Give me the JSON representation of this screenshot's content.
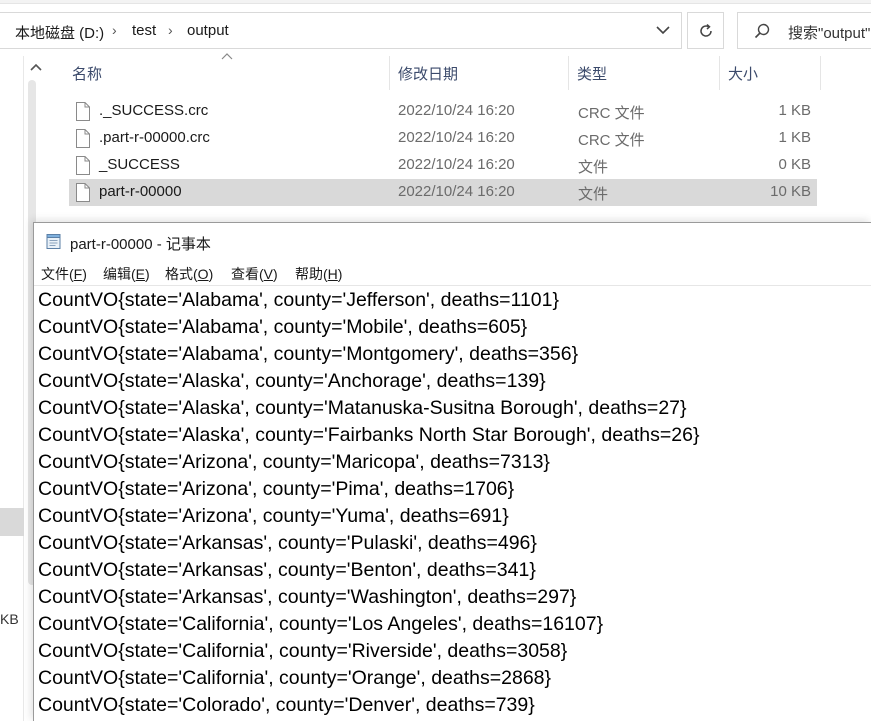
{
  "explorer": {
    "breadcrumb": [
      "本地磁盘 (D:)",
      "test",
      "output"
    ],
    "search_placeholder": "搜索\"output\"",
    "left_pane_size_fragment": "KB",
    "columns": {
      "name": "名称",
      "date": "修改日期",
      "type": "类型",
      "size": "大小"
    },
    "files": [
      {
        "name": "._SUCCESS.crc",
        "date": "2022/10/24 16:20",
        "type": "CRC 文件",
        "size": "1 KB"
      },
      {
        "name": ".part-r-00000.crc",
        "date": "2022/10/24 16:20",
        "type": "CRC 文件",
        "size": "1 KB"
      },
      {
        "name": "_SUCCESS",
        "date": "2022/10/24 16:20",
        "type": "文件",
        "size": "0 KB"
      },
      {
        "name": "part-r-00000",
        "date": "2022/10/24 16:20",
        "type": "文件",
        "size": "10 KB"
      }
    ],
    "selected_index": 3
  },
  "notepad": {
    "title": "part-r-00000 - 记事本",
    "menu": [
      {
        "label": "文件",
        "accel": "F"
      },
      {
        "label": "编辑",
        "accel": "E"
      },
      {
        "label": "格式",
        "accel": "O"
      },
      {
        "label": "查看",
        "accel": "V"
      },
      {
        "label": "帮助",
        "accel": "H"
      }
    ],
    "lines": [
      "CountVO{state='Alabama', county='Jefferson', deaths=1101}",
      "CountVO{state='Alabama', county='Mobile', deaths=605}",
      "CountVO{state='Alabama', county='Montgomery', deaths=356}",
      "CountVO{state='Alaska', county='Anchorage', deaths=139}",
      "CountVO{state='Alaska', county='Matanuska-Susitna Borough', deaths=27}",
      "CountVO{state='Alaska', county='Fairbanks North Star Borough', deaths=26}",
      "CountVO{state='Arizona', county='Maricopa', deaths=7313}",
      "CountVO{state='Arizona', county='Pima', deaths=1706}",
      "CountVO{state='Arizona', county='Yuma', deaths=691}",
      "CountVO{state='Arkansas', county='Pulaski', deaths=496}",
      "CountVO{state='Arkansas', county='Benton', deaths=341}",
      "CountVO{state='Arkansas', county='Washington', deaths=297}",
      "CountVO{state='California', county='Los Angeles', deaths=16107}",
      "CountVO{state='California', county='Riverside', deaths=3058}",
      "CountVO{state='California', county='Orange', deaths=2868}",
      "CountVO{state='Colorado', county='Denver', deaths=739}"
    ]
  },
  "colors": {
    "selection": "#d9d9d9",
    "header_text": "#3b4a6b",
    "muted_text": "#6b6b6b"
  }
}
